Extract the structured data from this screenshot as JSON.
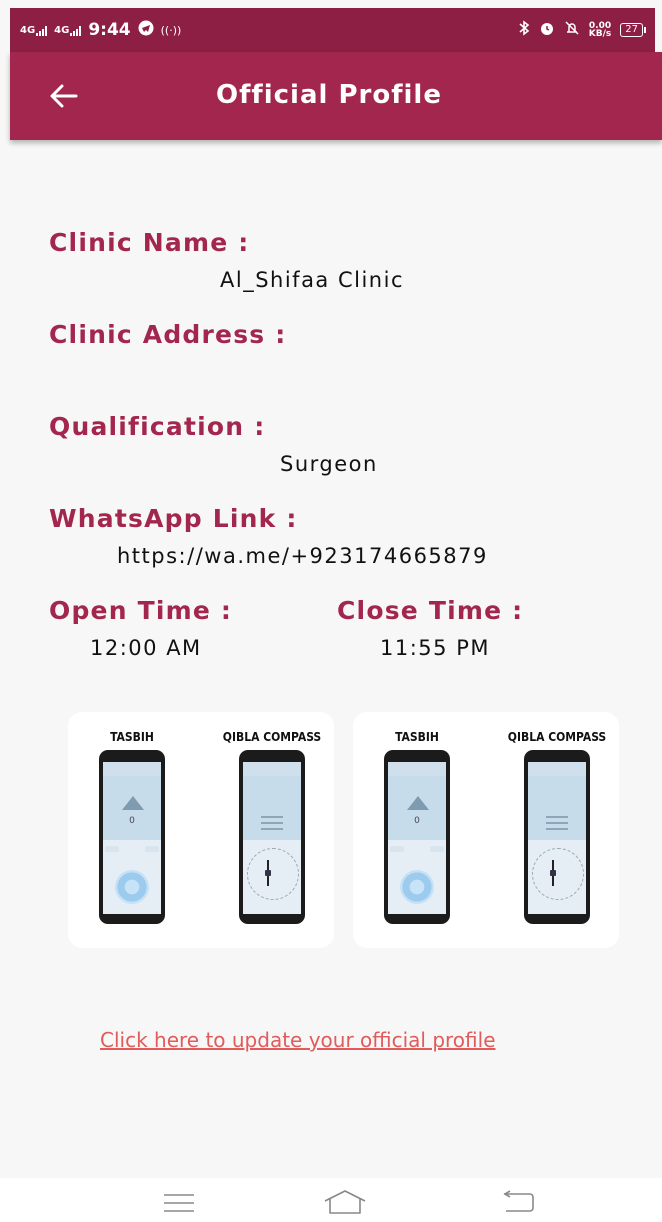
{
  "status_bar": {
    "sim1": "4G",
    "sim2": "4G",
    "time": "9:44",
    "net_speed": "0.00",
    "net_unit": "KB/s",
    "battery": "27"
  },
  "app_bar": {
    "title": "Official Profile",
    "back_icon": "arrow-left-icon"
  },
  "profile": {
    "clinic_name_label": "Clinic Name :",
    "clinic_name": "Al_Shifaa Clinic",
    "clinic_address_label": "Clinic Address :",
    "clinic_address": "",
    "qualification_label": "Qualification :",
    "qualification": "Surgeon",
    "whatsapp_label": "WhatsApp Link :",
    "whatsapp": "https://wa.me/+923174665879",
    "open_label": "Open Time :",
    "open_time": "12:00 AM",
    "close_label": "Close Time :",
    "close_time": "11:55 PM"
  },
  "promos": [
    {
      "left_caption": "TASBIH",
      "right_caption": "QIBLA COMPASS",
      "counter": "0"
    },
    {
      "left_caption": "TASBIH",
      "right_caption": "QIBLA COMPASS",
      "counter": "0"
    }
  ],
  "update_link": "Click here to update your official profile",
  "colors": {
    "status_bar": "#8e1f44",
    "app_bar": "#a3264e",
    "label": "#a3264e",
    "link": "#e15b5b"
  }
}
